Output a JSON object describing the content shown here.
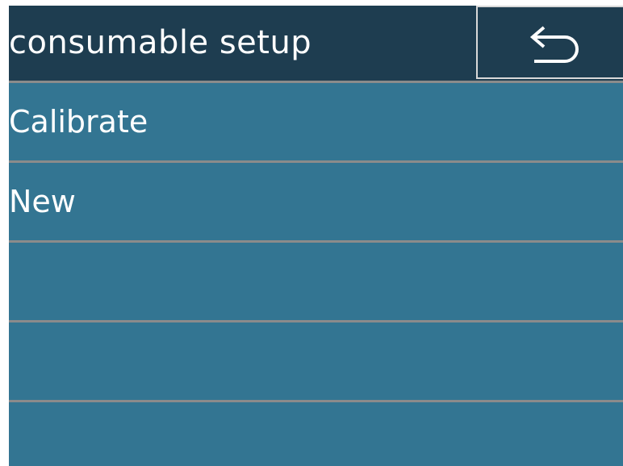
{
  "header": {
    "title": "consumable setup",
    "back_icon": "return-arrow-icon"
  },
  "menu": {
    "items": [
      {
        "label": "Calibrate"
      },
      {
        "label": "New"
      },
      {
        "label": ""
      },
      {
        "label": ""
      },
      {
        "label": ""
      }
    ]
  },
  "colors": {
    "header_bg": "#1e3d50",
    "menu_bg": "#337592",
    "divider": "#8b8b8b",
    "text": "#ffffff"
  }
}
